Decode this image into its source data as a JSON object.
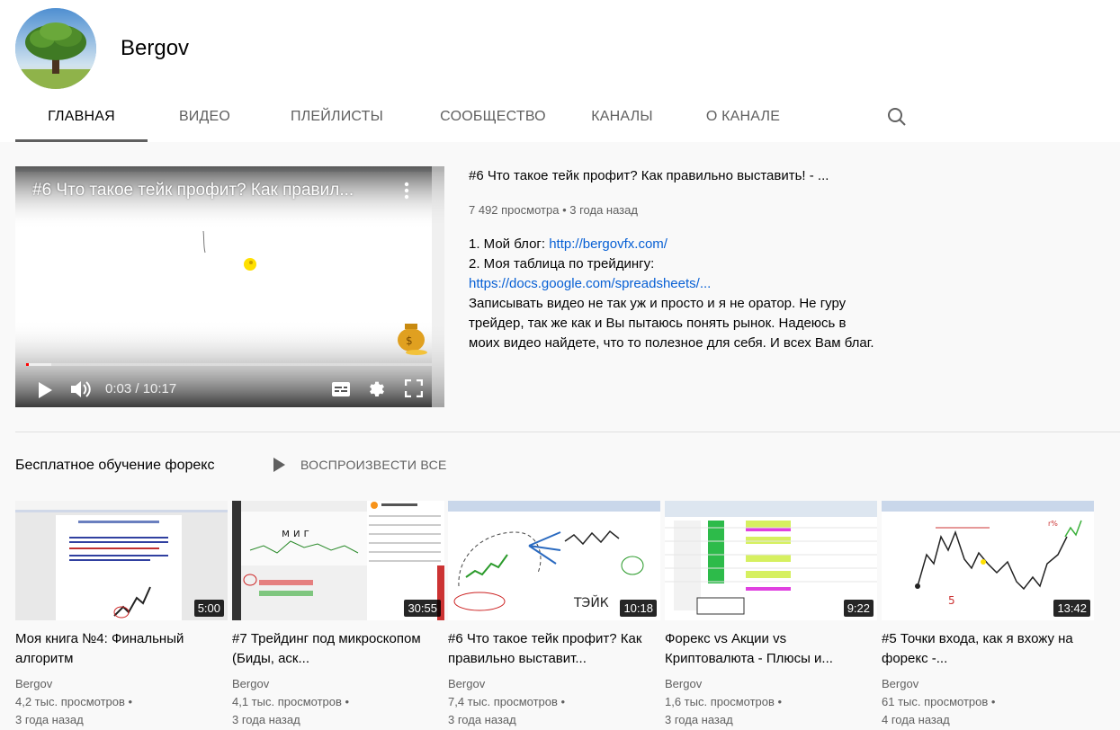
{
  "channel": {
    "name": "Bergov"
  },
  "tabs": [
    "ГЛАВНАЯ",
    "ВИДЕО",
    "ПЛЕЙЛИСТЫ",
    "СООБЩЕСТВО",
    "КАНАЛЫ",
    "О КАНАЛЕ"
  ],
  "active_tab": 0,
  "featured": {
    "player_title": "#6 Что такое тейк профит? Как правил...",
    "time": "0:03 / 10:17",
    "progress": 0.005,
    "title": "#6 Что такое тейк профит? Как правильно выставить! - ...",
    "views": "7 492 просмотра",
    "age": "3 года назад",
    "desc_line1_prefix": "1. Мой блог: ",
    "desc_link1": "http://bergovfx.com/",
    "desc_line2": "2. Моя таблица по трейдингу:",
    "desc_link2": "https://docs.google.com/spreadsheets/...",
    "desc_body": "Записывать видео не так уж и просто и я не оратор. Не гуру трейдер, так же как и Вы пытаюсь понять рынок. Надеюсь в моих видео найдете, что то полезное для себя. И всех Вам благ."
  },
  "shelf": {
    "title": "Бесплатное обучение форекс",
    "play_all": "ВОСПРОИЗВЕСТИ ВСЕ"
  },
  "videos": [
    {
      "title": "Моя книга №4: Финальный алгоритм",
      "duration": "5:00",
      "channel": "Bergov",
      "views": "4,2 тыс. просмотров",
      "age": "3 года назад"
    },
    {
      "title": "#7 Трейдинг под микроскопом (Биды, аск...",
      "duration": "30:55",
      "channel": "Bergov",
      "views": "4,1 тыс. просмотров",
      "age": "3 года назад"
    },
    {
      "title": "#6 Что такое тейк профит? Как правильно выставит...",
      "duration": "10:18",
      "channel": "Bergov",
      "views": "7,4 тыс. просмотров",
      "age": "3 года назад"
    },
    {
      "title": "Форекс vs Акции vs Криптовалюта - Плюсы и...",
      "duration": "9:22",
      "channel": "Bergov",
      "views": "1,6 тыс. просмотров",
      "age": "3 года назад"
    },
    {
      "title": "#5 Точки входа, как я вхожу на форекс -...",
      "duration": "13:42",
      "channel": "Bergov",
      "views": "61 тыс. просмотров",
      "age": "4 года назад"
    }
  ]
}
